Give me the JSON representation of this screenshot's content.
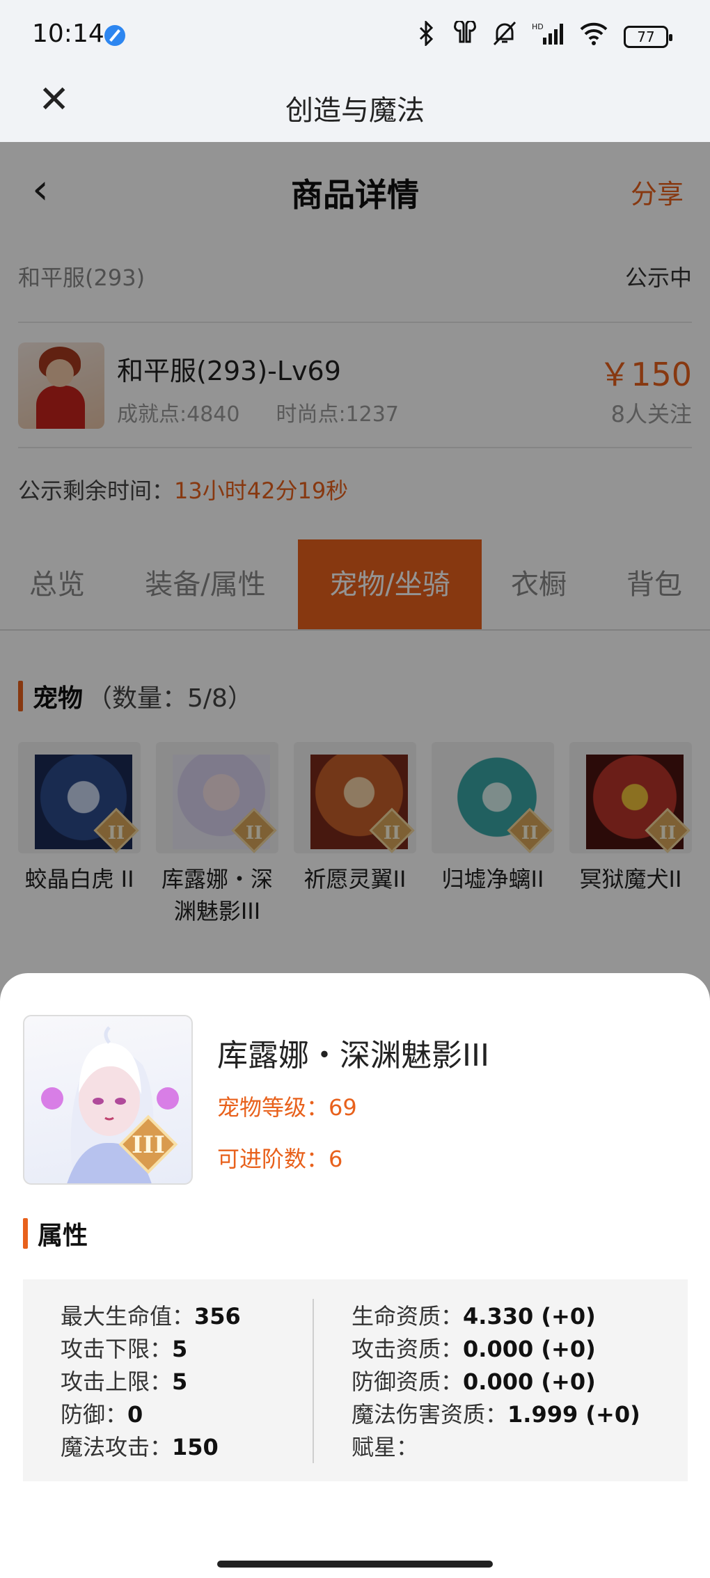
{
  "status_bar": {
    "time": "10:14",
    "battery": "77",
    "icons": [
      "compass-icon",
      "bluetooth-icon",
      "earbuds-icon",
      "mute-icon",
      "signal-icon",
      "wifi-icon",
      "battery-icon"
    ]
  },
  "mini_app": {
    "close_icon": "✕",
    "title": "创造与魔法"
  },
  "page": {
    "back_icon": "‹",
    "title": "商品详情",
    "share_label": "分享"
  },
  "server": {
    "name": "和平服(293)",
    "status": "公示中"
  },
  "character": {
    "name": "和平服(293)-Lv69",
    "achievement_points": "成就点:4840",
    "fashion_points": "时尚点:1237",
    "price": "￥150",
    "watchers": "8人关注"
  },
  "countdown": {
    "label": "公示剩余时间：",
    "value": "13小时42分19秒"
  },
  "tabs": [
    {
      "label": "总览",
      "active": false
    },
    {
      "label": "装备/属性",
      "active": false
    },
    {
      "label": "宠物/坐骑",
      "active": true
    },
    {
      "label": "衣橱",
      "active": false
    },
    {
      "label": "背包",
      "active": false
    }
  ],
  "pets_section": {
    "title": "宠物",
    "count": "（数量：5/8）",
    "items": [
      {
        "name": "蛟晶白虎 II",
        "grade": "II",
        "color": "#2c4a8a"
      },
      {
        "name": "库露娜・深渊魅影III",
        "grade": "II",
        "color": "#d9d2f0"
      },
      {
        "name": "祈愿灵翼II",
        "grade": "II",
        "color": "#c7602a"
      },
      {
        "name": "归墟净螭II",
        "grade": "II",
        "color": "#3aa6a6"
      },
      {
        "name": "冥狱魔犬II",
        "grade": "II",
        "color": "#b8342a"
      }
    ]
  },
  "detail_sheet": {
    "pet_name": "库露娜・深渊魅影III",
    "grade": "III",
    "level_label": "宠物等级：",
    "level_value": "69",
    "advance_label": "可进阶数：",
    "advance_value": "6",
    "attributes_title": "属性",
    "left_attributes": [
      {
        "label": "最大生命值：",
        "value": "356"
      },
      {
        "label": "攻击下限：",
        "value": "5"
      },
      {
        "label": "攻击上限：",
        "value": "5"
      },
      {
        "label": "防御：",
        "value": "0"
      },
      {
        "label": "魔法攻击：",
        "value": "150"
      }
    ],
    "right_attributes": [
      {
        "label": "生命资质：",
        "value": "4.330 (+0)"
      },
      {
        "label": "攻击资质：",
        "value": "0.000 (+0)"
      },
      {
        "label": "防御资质：",
        "value": "0.000 (+0)"
      },
      {
        "label": "魔法伤害资质：",
        "value": "1.999 (+0)"
      },
      {
        "label": "赋星：",
        "value": ""
      }
    ]
  },
  "colors": {
    "accent": "#e8611c",
    "overlay": "rgba(0,0,0,0.42)",
    "panel": "#f4f4f4"
  }
}
